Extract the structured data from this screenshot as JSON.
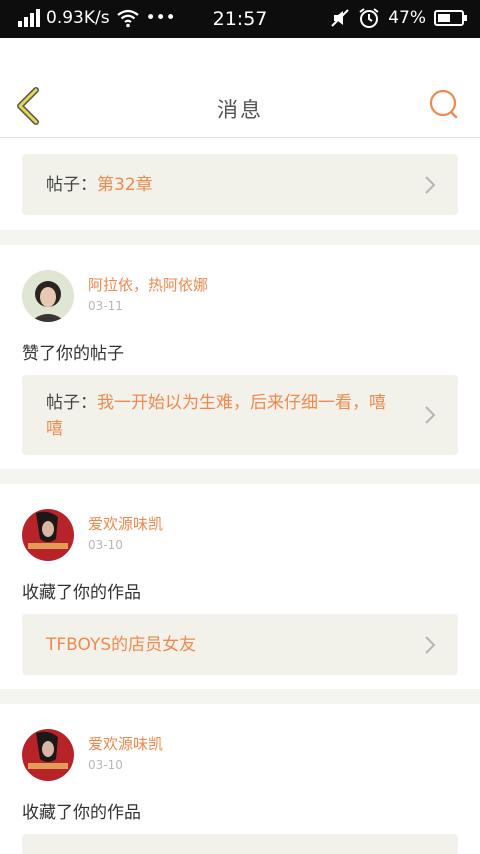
{
  "status_bar": {
    "speed": "0.93K/s",
    "dots": "•••",
    "time": "21:57",
    "battery": "47%"
  },
  "header": {
    "title": "消息"
  },
  "first_post": {
    "prefix": "帖子：",
    "title": "第32章"
  },
  "items": [
    {
      "user": "阿拉依，热阿依娜",
      "date": "03-11",
      "action": "赞了你的帖子",
      "post_prefix": "帖子：",
      "post_title": "我一开始以为生难，后来仔细一看，嘻嘻"
    },
    {
      "user": "爱欢源味凯",
      "date": "03-10",
      "action": "收藏了你的作品",
      "post_prefix": "",
      "post_title": "TFBOYS的店员女友"
    },
    {
      "user": "爱欢源味凯",
      "date": "03-10",
      "action": "收藏了你的作品"
    }
  ],
  "colors": {
    "accent": "#f0894e",
    "back_arrow": "#e7d94c",
    "post_bg": "#f2f2ea"
  }
}
